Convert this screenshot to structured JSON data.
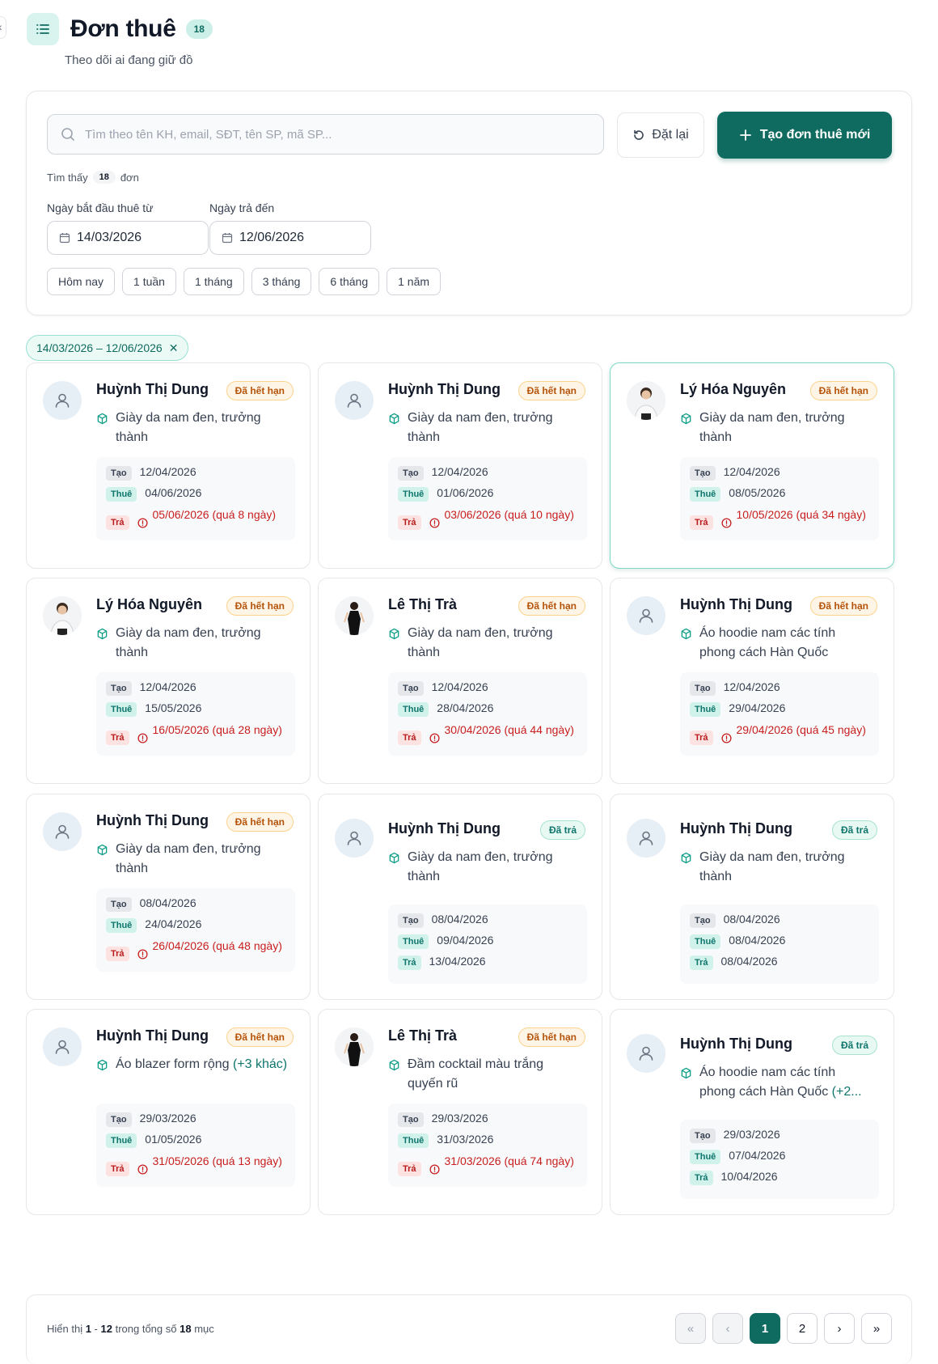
{
  "header": {
    "title": "Đơn thuê",
    "count": "18",
    "subtitle": "Theo dõi ai đang giữ đồ"
  },
  "filters": {
    "search_placeholder": "Tìm theo tên KH, email, SĐT, tên SP, mã SP...",
    "reset_label": "Đặt lại",
    "create_label": "Tạo đơn thuê mới",
    "found_prefix": "Tìm thấy",
    "found_count": "18",
    "found_suffix": "đơn",
    "start_label": "Ngày bắt đầu thuê từ",
    "start_value": "14/03/2026",
    "end_label": "Ngày trả đến",
    "end_value": "12/06/2026",
    "quick": [
      "Hôm nay",
      "1 tuần",
      "1 tháng",
      "3 tháng",
      "6 tháng",
      "1 năm"
    ]
  },
  "active_chip": "14/03/2026 – 12/06/2026",
  "labels": {
    "tao": "Tạo",
    "thue": "Thuê",
    "tra": "Trả"
  },
  "orders": [
    {
      "name": "Huỳnh Thị Dung",
      "status": "Đã hết hạn",
      "status_type": "expired",
      "avatar": "placeholder",
      "product": "Giày da nam đen, trưởng thành",
      "product_more": "",
      "created": "12/04/2026",
      "rent": "04/06/2026",
      "return": "05/06/2026 (quá 8 ngày)",
      "overdue": true
    },
    {
      "name": "Huỳnh Thị Dung",
      "status": "Đã hết hạn",
      "status_type": "expired",
      "avatar": "placeholder",
      "product": "Giày da nam đen, trưởng thành",
      "product_more": "",
      "created": "12/04/2026",
      "rent": "01/06/2026",
      "return": "03/06/2026 (quá 10 ngày)",
      "overdue": true
    },
    {
      "name": "Lý Hóa Nguyên",
      "status": "Đã hết hạn",
      "status_type": "expired",
      "avatar": "man-photo",
      "product": "Giày da nam đen, trưởng thành",
      "product_more": "",
      "created": "12/04/2026",
      "rent": "08/05/2026",
      "return": "10/05/2026 (quá 34 ngày)",
      "overdue": true,
      "selected": true
    },
    {
      "name": "Lý Hóa Nguyên",
      "status": "Đã hết hạn",
      "status_type": "expired",
      "avatar": "man-photo",
      "product": "Giày da nam đen, trưởng thành",
      "product_more": "",
      "created": "12/04/2026",
      "rent": "15/05/2026",
      "return": "16/05/2026 (quá 28 ngày)",
      "overdue": true
    },
    {
      "name": "Lê Thị Trà",
      "status": "Đã hết hạn",
      "status_type": "expired",
      "avatar": "woman-photo",
      "product": "Giày da nam đen, trưởng thành",
      "product_more": "",
      "created": "12/04/2026",
      "rent": "28/04/2026",
      "return": "30/04/2026 (quá 44 ngày)",
      "overdue": true
    },
    {
      "name": "Huỳnh Thị Dung",
      "status": "Đã hết hạn",
      "status_type": "expired",
      "avatar": "placeholder",
      "product": "Áo hoodie nam các tính phong cách Hàn Quốc",
      "product_more": "",
      "created": "12/04/2026",
      "rent": "29/04/2026",
      "return": "29/04/2026 (quá 45 ngày)",
      "overdue": true
    },
    {
      "name": "Huỳnh Thị Dung",
      "status": "Đã hết hạn",
      "status_type": "expired",
      "avatar": "placeholder",
      "product": "Giày da nam đen, trưởng thành",
      "product_more": "",
      "created": "08/04/2026",
      "rent": "24/04/2026",
      "return": "26/04/2026 (quá 48 ngày)",
      "overdue": true
    },
    {
      "name": "Huỳnh Thị Dung",
      "status": "Đã trả",
      "status_type": "returned",
      "avatar": "placeholder",
      "product": "Giày da nam đen, trưởng thành",
      "product_more": "",
      "created": "08/04/2026",
      "rent": "09/04/2026",
      "return": "13/04/2026",
      "overdue": false
    },
    {
      "name": "Huỳnh Thị Dung",
      "status": "Đã trả",
      "status_type": "returned",
      "avatar": "placeholder",
      "product": "Giày da nam đen, trưởng thành",
      "product_more": "",
      "created": "08/04/2026",
      "rent": "08/04/2026",
      "return": "08/04/2026",
      "overdue": false
    },
    {
      "name": "Huỳnh Thị Dung",
      "status": "Đã hết hạn",
      "status_type": "expired",
      "avatar": "placeholder",
      "product": "Áo blazer form rộng",
      "product_more": "(+3 khác)",
      "created": "29/03/2026",
      "rent": "01/05/2026",
      "return": "31/05/2026 (quá 13 ngày)",
      "overdue": true
    },
    {
      "name": "Lê Thị Trà",
      "status": "Đã hết hạn",
      "status_type": "expired",
      "avatar": "woman-photo",
      "product": "Đầm cocktail màu trắng quyến rũ",
      "product_more": "",
      "created": "29/03/2026",
      "rent": "31/03/2026",
      "return": "31/03/2026 (quá 74 ngày)",
      "overdue": true
    },
    {
      "name": "Huỳnh Thị Dung",
      "status": "Đã trả",
      "status_type": "returned",
      "avatar": "placeholder",
      "product": "Áo hoodie nam các tính phong cách Hàn Quốc",
      "product_more": "(+2...",
      "created": "29/03/2026",
      "rent": "07/04/2026",
      "return": "10/04/2026",
      "overdue": false
    }
  ],
  "pagination": {
    "prefix": "Hiển thị",
    "from": "1",
    "to": "12",
    "middle": "trong tổng số",
    "total": "18",
    "suffix": "mục",
    "pages": [
      "1",
      "2"
    ],
    "current": "1"
  },
  "colors": {
    "accent": "#0f6b5f",
    "expired": "#b45309",
    "overdue": "#c81e1e"
  }
}
